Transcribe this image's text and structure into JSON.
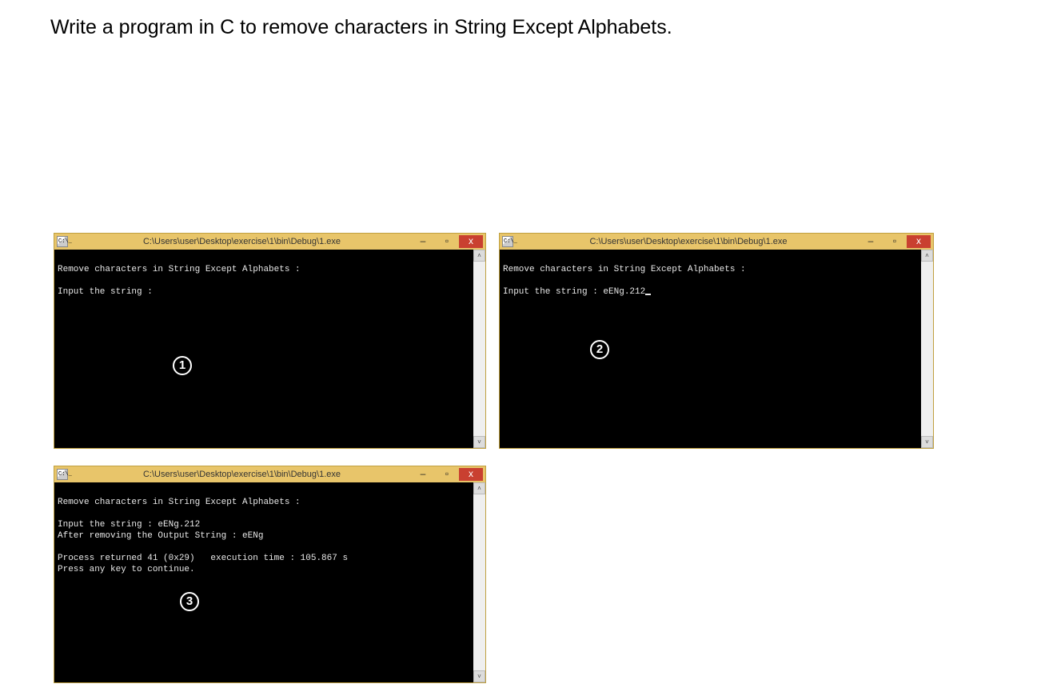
{
  "heading": "Write a program in C to remove characters in String Except Alphabets.",
  "windows": {
    "w1": {
      "title": "C:\\Users\\user\\Desktop\\exercise\\1\\bin\\Debug\\1.exe",
      "step_label": "1",
      "lines": {
        "l1": "Remove characters in String Except Alphabets :",
        "l2": "Input the string :"
      }
    },
    "w2": {
      "title": "C:\\Users\\user\\Desktop\\exercise\\1\\bin\\Debug\\1.exe",
      "step_label": "2",
      "lines": {
        "l1": "Remove characters in String Except Alphabets :",
        "l2": "Input the string : eENg.212"
      }
    },
    "w3": {
      "title": "C:\\Users\\user\\Desktop\\exercise\\1\\bin\\Debug\\1.exe",
      "step_label": "3",
      "lines": {
        "l1": "Remove characters in String Except Alphabets :",
        "l2": "Input the string : eENg.212",
        "l3": "After removing the Output String : eENg",
        "l4": "Process returned 41 (0x29)   execution time : 105.867 s",
        "l5": "Press any key to continue."
      }
    }
  },
  "controls": {
    "minimize": "–",
    "maximize": "▫",
    "close": "x",
    "scroll_up": "˄",
    "scroll_down": "˅"
  }
}
